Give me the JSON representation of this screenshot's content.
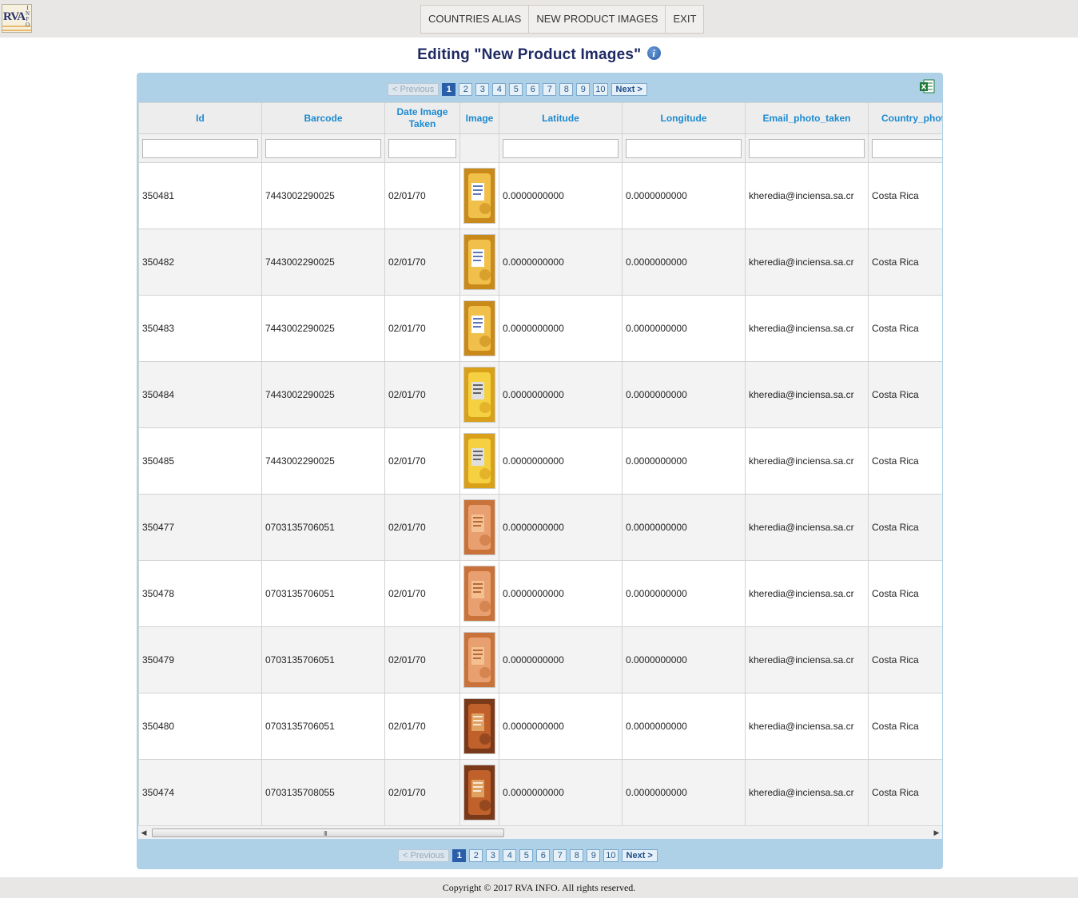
{
  "topbar": {
    "logo": {
      "main": "RVA",
      "side": "INFO"
    },
    "menu": [
      "COUNTRIES ALIAS",
      "NEW PRODUCT IMAGES",
      "EXIT"
    ]
  },
  "page": {
    "title": "Editing \"New Product Images\"",
    "info_icon": "i"
  },
  "pager": {
    "previous": "< Previous",
    "pages": [
      "1",
      "2",
      "3",
      "4",
      "5",
      "6",
      "7",
      "8",
      "9",
      "10"
    ],
    "active_page": "1",
    "next": "Next >"
  },
  "grid": {
    "columns": [
      "Id",
      "Barcode",
      "Date Image Taken",
      "Image",
      "Latitude",
      "Longitude",
      "Email_photo_taken",
      "Country_photo"
    ],
    "rows": [
      {
        "id": "350481",
        "barcode": "7443002290025",
        "date": "02/01/70",
        "lat": "0.0000000000",
        "lng": "0.0000000000",
        "email": "kheredia@inciensa.sa.cr",
        "country": "Costa Rica",
        "thumb": "orange"
      },
      {
        "id": "350482",
        "barcode": "7443002290025",
        "date": "02/01/70",
        "lat": "0.0000000000",
        "lng": "0.0000000000",
        "email": "kheredia@inciensa.sa.cr",
        "country": "Costa Rica",
        "thumb": "orange"
      },
      {
        "id": "350483",
        "barcode": "7443002290025",
        "date": "02/01/70",
        "lat": "0.0000000000",
        "lng": "0.0000000000",
        "email": "kheredia@inciensa.sa.cr",
        "country": "Costa Rica",
        "thumb": "orange"
      },
      {
        "id": "350484",
        "barcode": "7443002290025",
        "date": "02/01/70",
        "lat": "0.0000000000",
        "lng": "0.0000000000",
        "email": "kheredia@inciensa.sa.cr",
        "country": "Costa Rica",
        "thumb": "yellow"
      },
      {
        "id": "350485",
        "barcode": "7443002290025",
        "date": "02/01/70",
        "lat": "0.0000000000",
        "lng": "0.0000000000",
        "email": "kheredia@inciensa.sa.cr",
        "country": "Costa Rica",
        "thumb": "yellow"
      },
      {
        "id": "350477",
        "barcode": "0703135706051",
        "date": "02/01/70",
        "lat": "0.0000000000",
        "lng": "0.0000000000",
        "email": "kheredia@inciensa.sa.cr",
        "country": "Costa Rica",
        "thumb": "hand"
      },
      {
        "id": "350478",
        "barcode": "0703135706051",
        "date": "02/01/70",
        "lat": "0.0000000000",
        "lng": "0.0000000000",
        "email": "kheredia@inciensa.sa.cr",
        "country": "Costa Rica",
        "thumb": "hand"
      },
      {
        "id": "350479",
        "barcode": "0703135706051",
        "date": "02/01/70",
        "lat": "0.0000000000",
        "lng": "0.0000000000",
        "email": "kheredia@inciensa.sa.cr",
        "country": "Costa Rica",
        "thumb": "hand"
      },
      {
        "id": "350480",
        "barcode": "0703135706051",
        "date": "02/01/70",
        "lat": "0.0000000000",
        "lng": "0.0000000000",
        "email": "kheredia@inciensa.sa.cr",
        "country": "Costa Rica",
        "thumb": "brown"
      },
      {
        "id": "350474",
        "barcode": "0703135708055",
        "date": "02/01/70",
        "lat": "0.0000000000",
        "lng": "0.0000000000",
        "email": "kheredia@inciensa.sa.cr",
        "country": "Costa Rica",
        "thumb": "brown"
      }
    ]
  },
  "scrollbar": {
    "grip": "III"
  },
  "icons": {
    "excel": "excel-export-icon",
    "info": "info-icon"
  },
  "colors": {
    "panel": "#aed1e8",
    "header_text": "#1b8ad0",
    "title": "#1f2a64",
    "active_page": "#2a5ea8"
  },
  "footer": {
    "copyright": "Copyright © 2017 RVA INFO. All rights reserved."
  }
}
